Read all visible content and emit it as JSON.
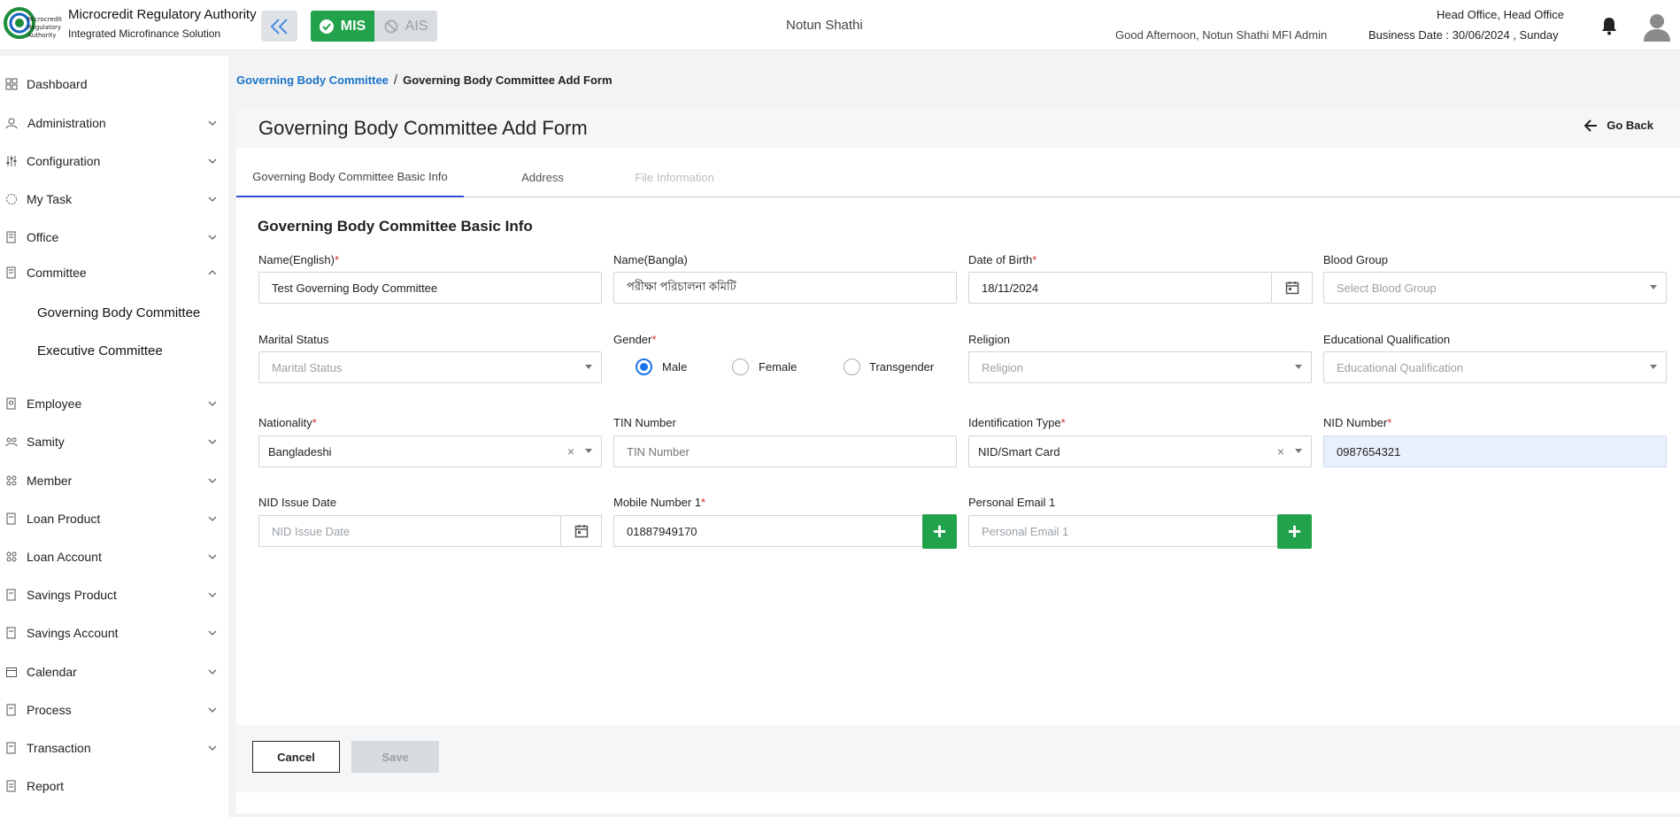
{
  "header": {
    "org_name": "Microcredit Regulatory Authority",
    "org_sub": "Integrated Microfinance Solution",
    "logo_text": "Microcredit Regulatory Authority",
    "mode_mis": "MIS",
    "mode_ais": "AIS",
    "center_name": "Notun Shathi",
    "greeting": "Good Afternoon, Notun Shathi MFI Admin",
    "office": "Head Office, Head Office",
    "business_date": "Business Date : 30/06/2024 , Sunday",
    "accent_color": "#22a24a"
  },
  "sidebar": {
    "items": [
      {
        "label": "Dashboard",
        "icon": "dashboard-icon"
      },
      {
        "label": "Administration",
        "icon": "admin-icon"
      },
      {
        "label": "Configuration",
        "icon": "config-icon"
      },
      {
        "label": "My Task",
        "icon": "task-icon"
      },
      {
        "label": "Office",
        "icon": "office-icon"
      },
      {
        "label": "Committee",
        "icon": "committee-icon"
      },
      {
        "label": "Employee",
        "icon": "employee-icon"
      },
      {
        "label": "Samity",
        "icon": "samity-icon"
      },
      {
        "label": "Member",
        "icon": "member-icon"
      },
      {
        "label": "Loan Product",
        "icon": "loan-product-icon"
      },
      {
        "label": "Loan Account",
        "icon": "loan-account-icon"
      },
      {
        "label": "Savings Product",
        "icon": "savings-product-icon"
      },
      {
        "label": "Savings Account",
        "icon": "savings-account-icon"
      },
      {
        "label": "Calendar",
        "icon": "calendar-icon"
      },
      {
        "label": "Process",
        "icon": "process-icon"
      },
      {
        "label": "Transaction",
        "icon": "transaction-icon"
      },
      {
        "label": "Report",
        "icon": "report-icon"
      }
    ],
    "committee_sub": [
      "Governing Body Committee",
      "Executive Committee"
    ]
  },
  "breadcrumb": {
    "parent": "Governing Body Committee",
    "separator": "/",
    "current": "Governing Body Committee Add Form"
  },
  "page": {
    "title": "Governing Body Committee Add Form",
    "go_back": "Go Back",
    "tabs": [
      "Governing Body Committee Basic Info",
      "Address",
      "File Information"
    ],
    "section_title": "Governing Body Committee Basic Info"
  },
  "form": {
    "name_en": {
      "label": "Name(English)",
      "value": "Test Governing Body Committee"
    },
    "name_bn": {
      "label": "Name(Bangla)",
      "value": "পরীক্ষা পরিচালনা কমিটি"
    },
    "dob": {
      "label": "Date of Birth",
      "value": "18/11/2024"
    },
    "blood_group": {
      "label": "Blood Group",
      "placeholder": "Select Blood Group"
    },
    "marital": {
      "label": "Marital Status",
      "placeholder": "Marital Status"
    },
    "gender": {
      "label": "Gender",
      "options": [
        "Male",
        "Female",
        "Transgender"
      ],
      "selected": "Male"
    },
    "religion": {
      "label": "Religion",
      "placeholder": "Religion"
    },
    "education": {
      "label": "Educational Qualification",
      "placeholder": "Educational Qualification"
    },
    "nationality": {
      "label": "Nationality",
      "value": "Bangladeshi"
    },
    "tin": {
      "label": "TIN Number",
      "placeholder": "TIN Number"
    },
    "id_type": {
      "label": "Identification Type",
      "value": "NID/Smart Card"
    },
    "nid": {
      "label": "NID Number",
      "value": "0987654321"
    },
    "nid_issue": {
      "label": "NID Issue Date",
      "placeholder": "NID Issue Date"
    },
    "mobile": {
      "label": "Mobile Number 1",
      "value": "01887949170"
    },
    "email": {
      "label": "Personal Email 1",
      "placeholder": "Personal Email 1"
    },
    "required_mark": "*",
    "clear_mark": "×",
    "add_mark": "+"
  },
  "footer": {
    "cancel": "Cancel",
    "save": "Save"
  }
}
